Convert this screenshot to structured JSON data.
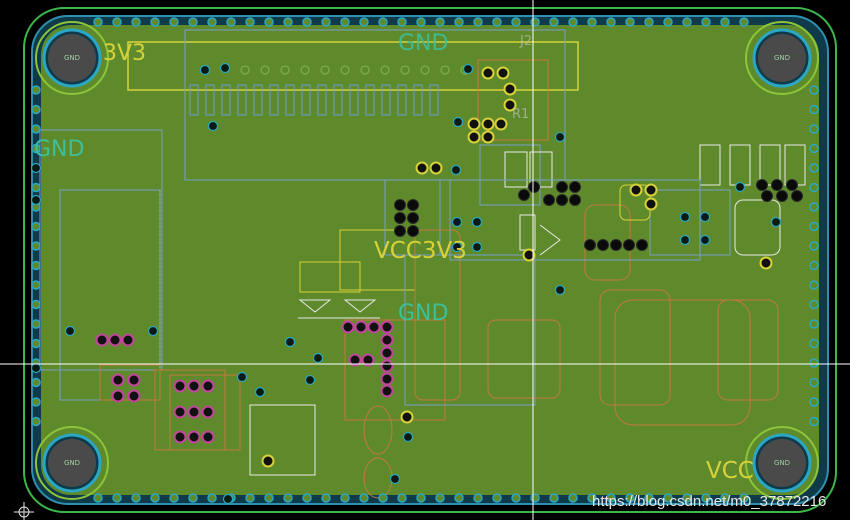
{
  "labels": {
    "gnd_top": "GND",
    "label_3v3": "3V3",
    "gnd_left": "GND",
    "vcc3v3": "VCC3V3",
    "gnd_mid": "GND",
    "vcc_br": "VCC",
    "j2": "J2",
    "r1": "R1"
  },
  "hole_label": "GND",
  "watermark": "https://blog.csdn.net/m0_37872216",
  "colors": {
    "background": "#000000",
    "copper": "#5f8a2b",
    "outline": "#3bb84a",
    "stitch_ring": "#2aa7c4",
    "silk_yellow": "#d8d23a",
    "silk_teal": "#3dbf9a",
    "pad_magenta": "#c2469c",
    "pad_yellow": "#d8d23a",
    "crosshair": "#ffffff",
    "watermark": "#e8e8e8"
  }
}
